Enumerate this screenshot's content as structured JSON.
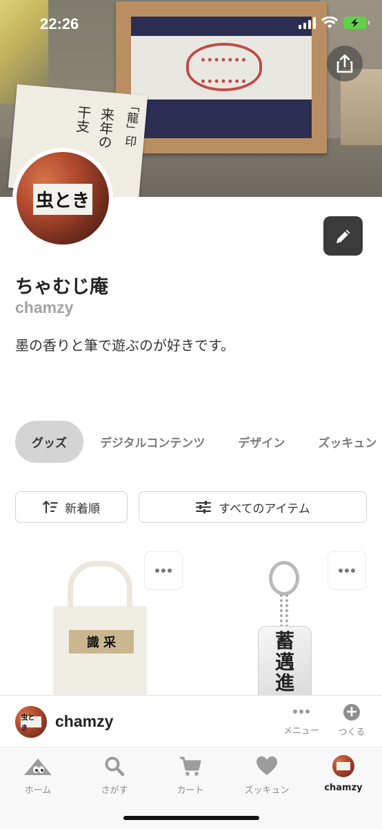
{
  "status_bar": {
    "time": "22:26"
  },
  "hero": {
    "note_lines": [
      "来年の",
      "干支"
    ],
    "note_seal": "「龍」印"
  },
  "profile": {
    "avatar_text": "虫とき",
    "name": "ちゃむじ庵",
    "handle": "chamzy",
    "bio": "墨の香りと筆で遊ぶのが好きです。"
  },
  "tabs": [
    {
      "label": "グッズ",
      "active": true
    },
    {
      "label": "デジタルコンテンツ",
      "active": false
    },
    {
      "label": "デザイン",
      "active": false
    },
    {
      "label": "ズッキュン",
      "active": false
    }
  ],
  "filters": {
    "sort_label": "新着順",
    "all_items_label": "すべてのアイテム"
  },
  "items": [
    {
      "kind": "tote-bag",
      "print_text": "識 采"
    },
    {
      "kind": "acrylic-keyholder",
      "print_text": [
        "蓄",
        "邁",
        "進"
      ]
    }
  ],
  "creator_bar": {
    "name": "chamzy",
    "menu_label": "メニュー",
    "create_label": "つくる"
  },
  "tabbar": [
    {
      "label": "ホーム",
      "icon": "home-mountain-icon"
    },
    {
      "label": "さがす",
      "icon": "search-icon"
    },
    {
      "label": "カート",
      "icon": "cart-icon"
    },
    {
      "label": "ズッキュン",
      "icon": "heart-icon"
    },
    {
      "label": "chamzy",
      "icon": "avatar",
      "active": true
    }
  ],
  "colors": {
    "accent_dark": "#3b3b3b",
    "tab_active_bg": "#d4d4d4",
    "muted_text": "#a3a3a3",
    "battery_green": "#63d147"
  }
}
